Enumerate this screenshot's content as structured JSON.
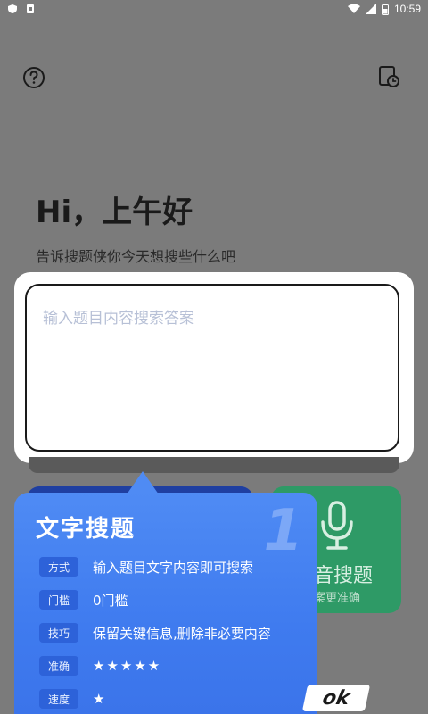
{
  "status_bar": {
    "time": "10:59"
  },
  "greeting": {
    "title": "Hi，上午好",
    "subtitle": "告诉搜题侠你今天想搜些什么吧"
  },
  "search": {
    "placeholder": "输入题目内容搜索答案"
  },
  "voice_card": {
    "label": "音搜题",
    "sub": "案更准确"
  },
  "popup": {
    "title": "文字搜题",
    "watermark": "1",
    "rows": [
      {
        "tag": "方式",
        "value": "输入题目文字内容即可搜索"
      },
      {
        "tag": "门槛",
        "value": "0门槛"
      },
      {
        "tag": "技巧",
        "value": "保留关键信息,删除非必要内容"
      },
      {
        "tag": "准确",
        "value": "★★★★★"
      },
      {
        "tag": "速度",
        "value": "★"
      }
    ],
    "ok_label": "ok"
  },
  "colors": {
    "popup_blue": "#4f8bf4",
    "voice_green": "#2e9a66",
    "tag_blue": "#2d62d9"
  },
  "icons": {
    "help": "question-circle-icon",
    "history": "clock-document-icon",
    "mic": "microphone-icon"
  }
}
